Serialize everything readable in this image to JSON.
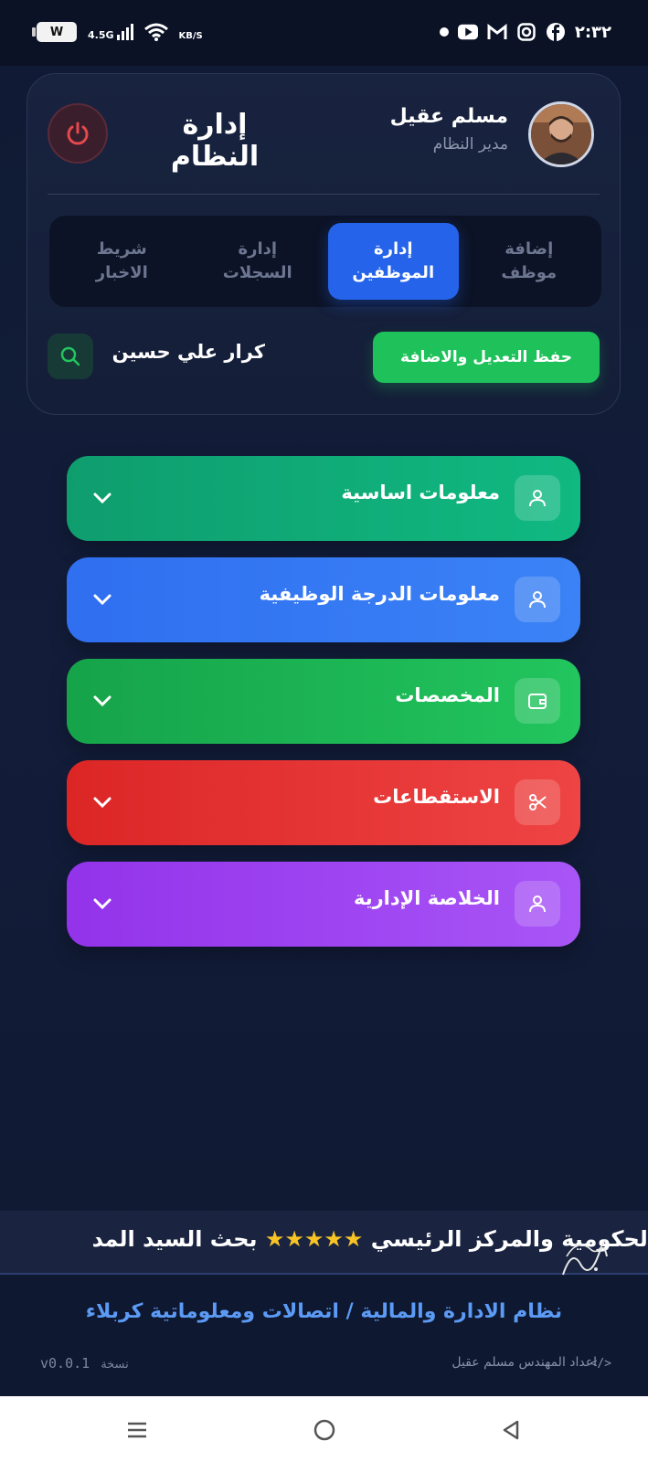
{
  "status_bar": {
    "time": "٢:٣٢",
    "battery_label": "W",
    "network": "4.5G",
    "speed_unit": "KB/S"
  },
  "header": {
    "app_title": "إدارة النظام",
    "user_name": "مسلم عقيل",
    "user_role": "مدير النظام"
  },
  "tabs": [
    {
      "label_line1": "إضافة",
      "label_line2": "موظف",
      "active": false
    },
    {
      "label_line1": "إدارة",
      "label_line2": "الموظفين",
      "active": true
    },
    {
      "label_line1": "إدارة",
      "label_line2": "السجلات",
      "active": false
    },
    {
      "label_line1": "شريط",
      "label_line2": "الاخبار",
      "active": false
    }
  ],
  "actions": {
    "save_label": "حفظ التعديل والاضافة",
    "employee_name": "كرار علي حسين"
  },
  "sections": [
    {
      "label": "معلومات اساسية",
      "icon": "user-icon",
      "color": "#10b981"
    },
    {
      "label": "معلومات الدرجة الوظيفية",
      "icon": "user-icon",
      "color": "#3b82f6"
    },
    {
      "label": "المخصصات",
      "icon": "wallet-icon",
      "color": "#22c55e"
    },
    {
      "label": "الاستقطاعات",
      "icon": "scissors-icon",
      "color": "#ef4444"
    },
    {
      "label": "الخلاصة الإدارية",
      "icon": "user-icon",
      "color": "#a855f7"
    }
  ],
  "ticker": {
    "text_before": "الحكومية والمركز الرئيسي",
    "stars": "★★★★★",
    "text_after": "بحث السيد المد"
  },
  "footer": {
    "system_name": "نظام الادارة والمالية / اتصالات ومعلوماتية كربلاء",
    "version": "v0.0.1",
    "version_label": "نسخة",
    "credit": "اعداد المهندس  مسلم عقيل",
    "code_icon": "</>"
  },
  "colors": {
    "accent": "#2563eb",
    "save": "#1fc25a",
    "power": "#e5484d"
  }
}
